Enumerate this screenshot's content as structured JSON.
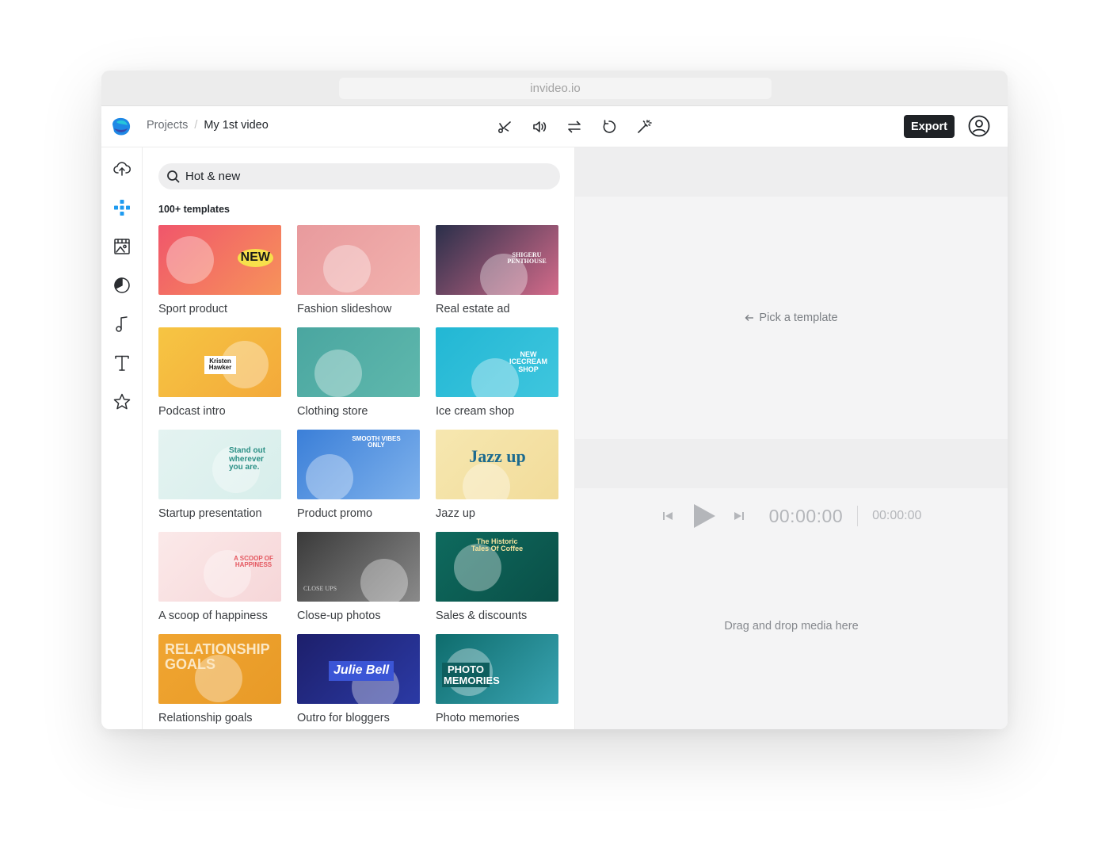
{
  "browser": {
    "url": "invideo.io"
  },
  "breadcrumb": {
    "projects": "Projects",
    "separator": "/",
    "current": "My 1st video"
  },
  "toolbar": {
    "tools": [
      "scissors-icon",
      "volume-icon",
      "swap-icon",
      "rotate-icon",
      "magic-wand-icon"
    ],
    "export_label": "Export"
  },
  "sidebar": {
    "items": [
      "upload-icon",
      "templates-icon",
      "media-icon",
      "elements-icon",
      "music-icon",
      "text-icon",
      "favorites-icon"
    ]
  },
  "search": {
    "value": "Hot & new"
  },
  "templates": {
    "count_label": "100+ templates",
    "items": [
      {
        "label": "Sport product",
        "thumb_text": "NEW",
        "colors": [
          "#f0566b",
          "#f7935a"
        ]
      },
      {
        "label": "Fashion slideshow",
        "thumb_text": "",
        "colors": [
          "#e89a9d",
          "#f2b2ae"
        ]
      },
      {
        "label": "Real estate ad",
        "thumb_text": "SHIGERU PENTHOUSE",
        "colors": [
          "#2a2f4a",
          "#d46b8a"
        ]
      },
      {
        "label": "Podcast intro",
        "thumb_text": "Kristen Hawker",
        "colors": [
          "#f6c543",
          "#f3a93a"
        ]
      },
      {
        "label": "Clothing store",
        "thumb_text": "",
        "colors": [
          "#4aa6a0",
          "#5fb8ad"
        ]
      },
      {
        "label": "Ice cream shop",
        "thumb_text": "NEW ICECREAM SHOP",
        "colors": [
          "#22b7d4",
          "#3fc6de"
        ]
      },
      {
        "label": "Startup presentation",
        "thumb_text": "Stand out wherever you are.",
        "colors": [
          "#e4f3f1",
          "#d7eeeb"
        ]
      },
      {
        "label": "Product promo",
        "thumb_text": "SMOOTH VIBES ONLY",
        "colors": [
          "#3b7fd8",
          "#7fb2ec"
        ]
      },
      {
        "label": "Jazz up",
        "thumb_text": "Jazz up",
        "colors": [
          "#f6e7b0",
          "#f2dc9a"
        ]
      },
      {
        "label": "A scoop of happiness",
        "thumb_text": "A SCOOP OF HAPPINESS",
        "colors": [
          "#fbe9e9",
          "#f6d6d8"
        ]
      },
      {
        "label": "Close-up photos",
        "thumb_text": "CLOSE UPS",
        "colors": [
          "#3a3a3a",
          "#8a8a8a"
        ]
      },
      {
        "label": "Sales & discounts",
        "thumb_text": "The Historic Tales Of Coffee",
        "colors": [
          "#0e6a5e",
          "#0a4f47"
        ]
      },
      {
        "label": "Relationship goals",
        "thumb_text": "RELATIONSHIP GOALS",
        "colors": [
          "#f0a531",
          "#e89a27"
        ]
      },
      {
        "label": "Outro for bloggers",
        "thumb_text": "Julie Bell",
        "colors": [
          "#1d1f6b",
          "#2b3aa5"
        ]
      },
      {
        "label": "Photo memories",
        "thumb_text": "PHOTO MEMORIES",
        "colors": [
          "#0e6c6c",
          "#3aa4b3"
        ]
      }
    ]
  },
  "preview": {
    "pick_template": "Pick a template",
    "time_current": "00:00:00",
    "time_total": "00:00:00",
    "drop_hint": "Drag and drop media here"
  },
  "colors": {
    "accent": "#1f9bf0",
    "export_bg": "#1f2226",
    "panel_bg": "#f4f4f5"
  }
}
